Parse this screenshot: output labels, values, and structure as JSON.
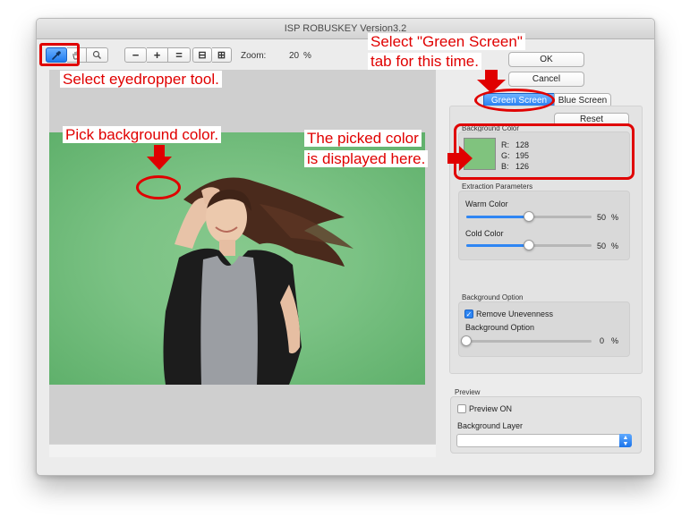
{
  "window": {
    "title": "ISP ROBUSKEY Version3.2"
  },
  "toolbar": {
    "zoom_label": "Zoom:",
    "zoom_value": "20",
    "zoom_unit": "%",
    "tools": [
      {
        "name": "eyedropper-icon",
        "active": true
      },
      {
        "name": "hand-icon",
        "active": false
      },
      {
        "name": "magnifier-icon",
        "active": false
      }
    ],
    "zoom_buttons": [
      {
        "name": "zoom-out-button",
        "glyph": "−"
      },
      {
        "name": "zoom-in-button",
        "glyph": "+"
      },
      {
        "name": "zoom-actual-button",
        "glyph": "="
      },
      {
        "name": "fit-width-icon",
        "glyph": "⊟"
      },
      {
        "name": "fit-height-icon",
        "glyph": "⊞"
      }
    ]
  },
  "dialog": {
    "ok_label": "OK",
    "cancel_label": "Cancel"
  },
  "tabs": [
    {
      "label": "Green Screen",
      "selected": true
    },
    {
      "label": "Blue Screen",
      "selected": false
    }
  ],
  "reset_label": "Reset",
  "background_color": {
    "title": "Background Color",
    "swatch": "#80c37e",
    "r_label": "R:",
    "r": "128",
    "g_label": "G:",
    "g": "195",
    "b_label": "B:",
    "b": "126"
  },
  "extraction": {
    "title": "Extraction Parameters",
    "warm_label": "Warm Color",
    "warm_value": "50",
    "warm_unit": "%",
    "warm_level": 0.5,
    "cold_label": "Cold Color",
    "cold_value": "50",
    "cold_unit": "%",
    "cold_level": 0.5
  },
  "bg_option": {
    "title": "Background Option",
    "remove_label": "Remove Unevenness",
    "remove_checked": true,
    "option_label": "Background Option",
    "option_value": "0",
    "option_unit": "%",
    "option_level": 0.0
  },
  "preview": {
    "title": "Preview",
    "preview_on_label": "Preview ON",
    "preview_on_checked": false,
    "layer_label": "Background Layer",
    "layer_value": ""
  },
  "annotations": {
    "eyedropper": "Select eyedropper tool.",
    "green_tab_1": "Select \"Green Screen\"",
    "green_tab_2": "tab for this time.",
    "pick": "Pick background color.",
    "picked_1": "The picked color",
    "picked_2": "is displayed here."
  },
  "colors": {
    "accent": "#2f86f3",
    "annotation": "#e00000",
    "green_screen": "#7bc284"
  }
}
